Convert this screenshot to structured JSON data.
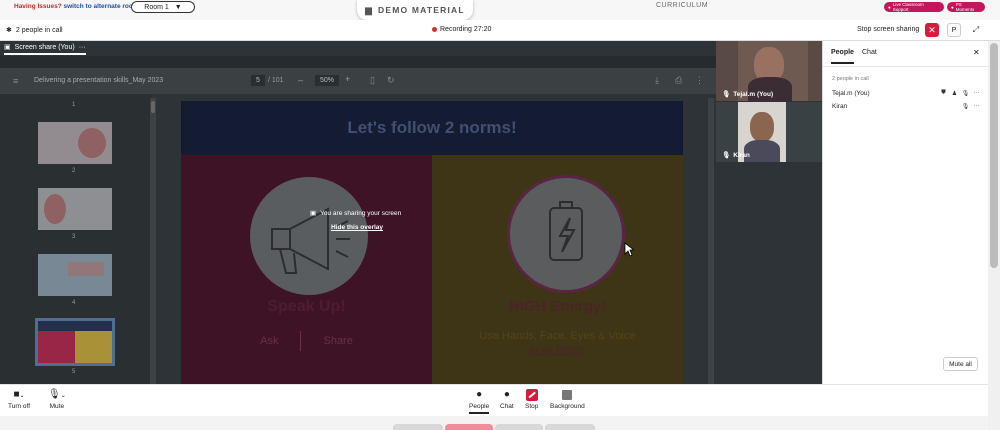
{
  "site_bar": {
    "issue_text": "Having Issues?",
    "switch_text": "switch to alternate room",
    "room_label": "Room 1",
    "demo_label": "DEMO MATERIAL",
    "curriculum_label": "CURRICULUM",
    "pill_support": "Live Classroom Support",
    "pill_moments": "PS Moments"
  },
  "call_header": {
    "people_count": "2 people in call",
    "recording": "Recording 27:20",
    "stop_sharing": "Stop screen sharing",
    "p_label": "P"
  },
  "share": {
    "tab_label": "Screen share (You)",
    "pdf_title": "Delivering a presentation skills_May 2023",
    "page_value": "5",
    "page_total": "/ 101",
    "zoom_value": "50%",
    "thumbs": [
      {
        "num": "1"
      },
      {
        "num": "2"
      },
      {
        "num": "3"
      },
      {
        "num": "4"
      },
      {
        "num": "5"
      }
    ],
    "slide": {
      "title": "Let's follow 2 norms!",
      "left_heading": "Speak Up!",
      "left_ask": "Ask",
      "left_share": "Share",
      "right_heading": "HIGH Energy!",
      "right_text": "Use Hands, Face, Eyes & Voice",
      "right_underline": "at all times!"
    },
    "overlay_message": "You are sharing your screen",
    "overlay_link": "Hide this overlay"
  },
  "videos": [
    {
      "name": "Tejal.m (You)"
    },
    {
      "name": "Kiran"
    }
  ],
  "panel": {
    "tab_people": "People",
    "tab_chat": "Chat",
    "in_call": "2 people in call",
    "people": [
      {
        "name": "Tejal.m (You)"
      },
      {
        "name": "Kiran"
      }
    ],
    "mute_all": "Mute all"
  },
  "toolbar": {
    "turn_off": "Turn off",
    "mute": "Mute",
    "people": "People",
    "chat": "Chat",
    "stop": "Stop",
    "background": "Background"
  },
  "colors": {
    "accent_red": "#d81b3d",
    "pill_pink": "#c2185b",
    "share_bg": "#2d3336"
  }
}
